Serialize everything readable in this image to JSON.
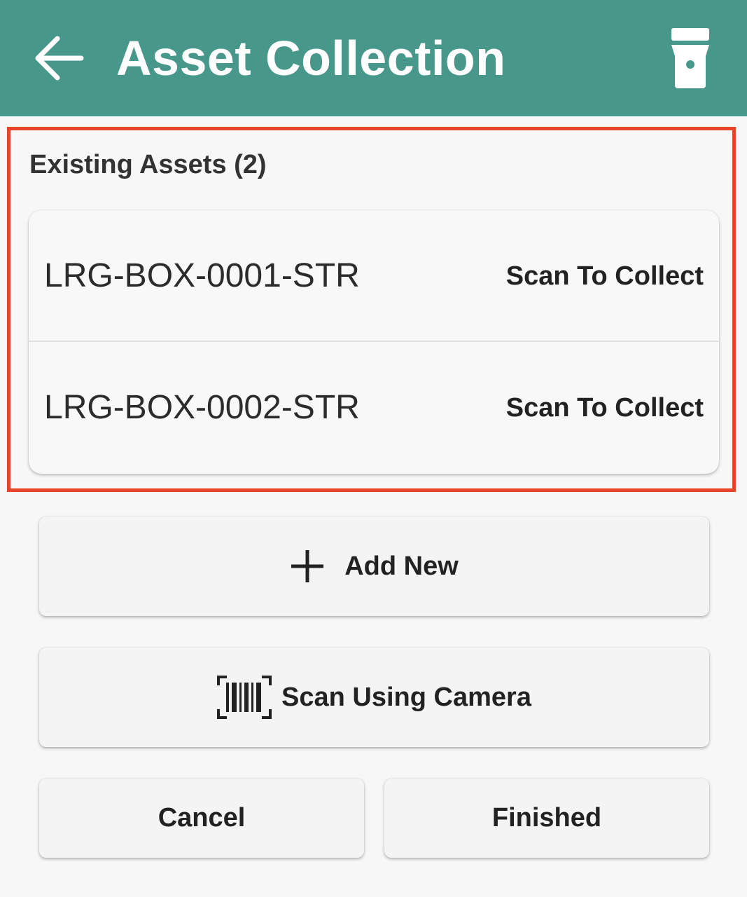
{
  "app_bar": {
    "title": "Asset Collection",
    "back_icon": "arrow-left-icon",
    "flashlight_icon": "flashlight-icon",
    "background_color": "#48978b"
  },
  "assets": {
    "header": "Existing Assets (2)",
    "highlight_color": "#e8432b",
    "items": [
      {
        "id": "LRG-BOX-0001-STR",
        "action": "Scan To Collect"
      },
      {
        "id": "LRG-BOX-0002-STR",
        "action": "Scan To Collect"
      }
    ]
  },
  "buttons": {
    "add_new": {
      "label": "Add New",
      "icon": "plus-icon"
    },
    "scan_camera": {
      "label": "Scan Using Camera",
      "icon": "barcode-scan-icon"
    },
    "cancel": {
      "label": "Cancel"
    },
    "finished": {
      "label": "Finished"
    }
  }
}
